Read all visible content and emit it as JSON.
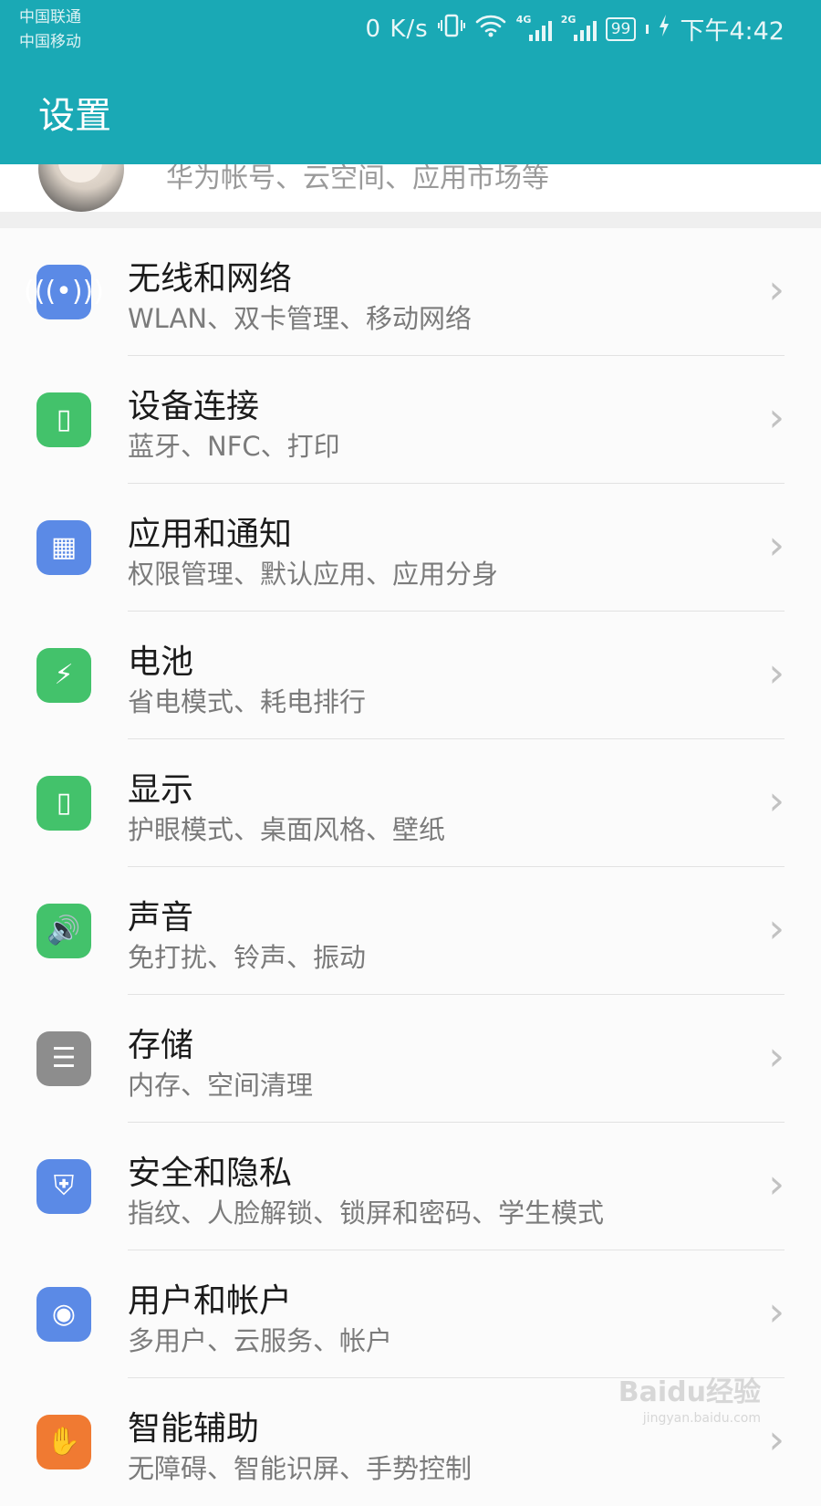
{
  "status_bar": {
    "carrier_1": "中国联通",
    "carrier_2": "中国移动",
    "network_speed": "0 K/s",
    "signal_1_gen": "4G",
    "signal_2_gen": "2G",
    "battery": "99",
    "time": "下午4:42"
  },
  "header": {
    "title": "设置"
  },
  "account": {
    "subtitle": "华为帐号、云空间、应用市场等"
  },
  "menu": [
    {
      "title": "无线和网络",
      "subtitle": "WLAN、双卡管理、移动网络",
      "icon": "wifi-icon",
      "color": "#5b8ae6",
      "glyph": "(((•)))"
    },
    {
      "title": "设备连接",
      "subtitle": "蓝牙、NFC、打印",
      "icon": "device-connection-icon",
      "color": "#43c26b",
      "glyph": "▯"
    },
    {
      "title": "应用和通知",
      "subtitle": "权限管理、默认应用、应用分身",
      "icon": "apps-grid-icon",
      "color": "#5b8ae6",
      "glyph": "▦"
    },
    {
      "title": "电池",
      "subtitle": "省电模式、耗电排行",
      "icon": "battery-icon",
      "color": "#43c26b",
      "glyph": "⚡"
    },
    {
      "title": "显示",
      "subtitle": "护眼模式、桌面风格、壁纸",
      "icon": "display-icon",
      "color": "#43c26b",
      "glyph": "▯"
    },
    {
      "title": "声音",
      "subtitle": "免打扰、铃声、振动",
      "icon": "speaker-icon",
      "color": "#43c26b",
      "glyph": "🔊"
    },
    {
      "title": "存储",
      "subtitle": "内存、空间清理",
      "icon": "storage-icon",
      "color": "#8d8d8d",
      "glyph": "☰"
    },
    {
      "title": "安全和隐私",
      "subtitle": "指纹、人脸解锁、锁屏和密码、学生模式",
      "icon": "shield-icon",
      "color": "#5b8ae6",
      "glyph": "⛨"
    },
    {
      "title": "用户和帐户",
      "subtitle": "多用户、云服务、帐户",
      "icon": "user-icon",
      "color": "#5b8ae6",
      "glyph": "◉"
    },
    {
      "title": "智能辅助",
      "subtitle": "无障碍、智能识屏、手势控制",
      "icon": "hand-icon",
      "color": "#f07a32",
      "glyph": "✋"
    }
  ],
  "chevron": "›",
  "watermark": {
    "main": "Baidu经验",
    "sub": "jingyan.baidu.com"
  }
}
